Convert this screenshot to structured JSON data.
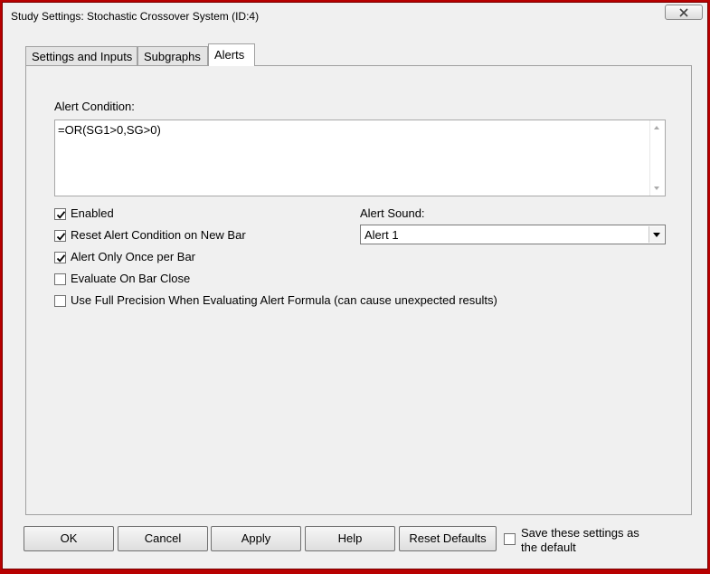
{
  "window": {
    "title": "Study Settings: Stochastic Crossover System (ID:4)"
  },
  "tabs": [
    {
      "label": "Settings and Inputs",
      "active": false
    },
    {
      "label": "Subgraphs",
      "active": false
    },
    {
      "label": "Alerts",
      "active": true
    }
  ],
  "alerts": {
    "condition_label": "Alert Condition:",
    "condition_value": "=OR(SG1>0,SG>0)",
    "sound_label": "Alert Sound:",
    "sound_value": "Alert 1",
    "options": [
      {
        "label": "Enabled",
        "checked": true
      },
      {
        "label": "Reset Alert Condition on New Bar",
        "checked": true
      },
      {
        "label": "Alert Only Once per Bar",
        "checked": true
      },
      {
        "label": "Evaluate On Bar Close",
        "checked": false
      },
      {
        "label": "Use Full Precision When Evaluating Alert Formula (can cause unexpected results)",
        "checked": false
      }
    ]
  },
  "buttons": {
    "ok": "OK",
    "cancel": "Cancel",
    "apply": "Apply",
    "help": "Help",
    "reset_defaults": "Reset Defaults"
  },
  "save_default": {
    "label": "Save these settings as the default",
    "checked": false
  },
  "colors": {
    "frame": "#b80000",
    "dialog_bg": "#f0f0f0"
  }
}
